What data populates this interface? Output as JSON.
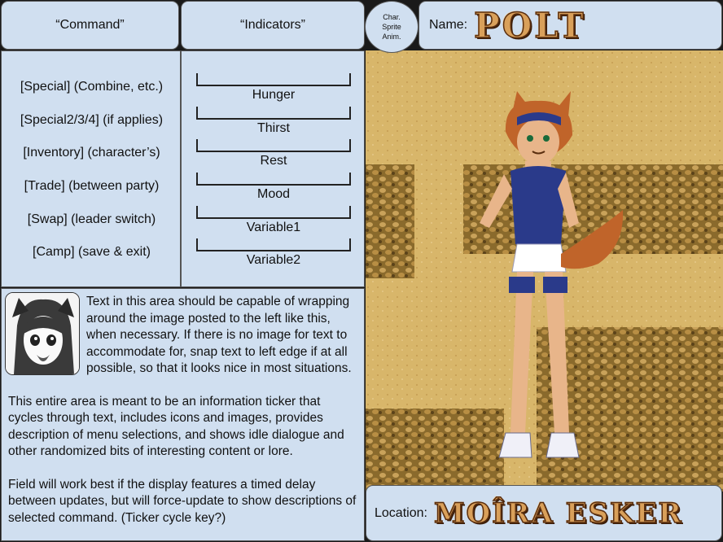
{
  "headers": {
    "command": "“Command”",
    "indicators": "“Indicators”"
  },
  "char_circle": {
    "line1": "Char.",
    "line2": "Sprite",
    "line3": "Anim."
  },
  "name": {
    "label": "Name:",
    "value": "POLT"
  },
  "commands": [
    "[Special] (Combine, etc.)",
    "[Special2/3/4] (if applies)",
    "[Inventory] (character’s)",
    "[Trade] (between party)",
    "[Swap] (leader switch)",
    "[Camp] (save & exit)"
  ],
  "indicators": [
    "Hunger",
    "Thirst",
    "Rest",
    "Mood",
    "Variable1",
    "Variable2"
  ],
  "ticker": {
    "paragraphs": [
      "Text in this area should be capable of wrapping around the image posted to the left like this, when necessary. If there is no image for text to accommodate for, snap text to left edge if at all possible, so that it looks nice in most situations.",
      "This entire area is meant to be an information ticker that cycles through text, includes icons and images, provides description of menu selections, and shows idle dialogue and other randomized bits of interesting content or lore.",
      "Field will work best if the display features a timed delay between updates, but will force-update to show descriptions of selected command. (Ticker cycle key?)"
    ]
  },
  "location": {
    "label": "Location:",
    "value": "MOÎRA ESKER"
  },
  "colors": {
    "panel": "#d0dff0",
    "sand": "#d8b66a",
    "rock": "#8a6a2c",
    "hair": "#c0642a",
    "outfit": "#2a3a8a"
  }
}
